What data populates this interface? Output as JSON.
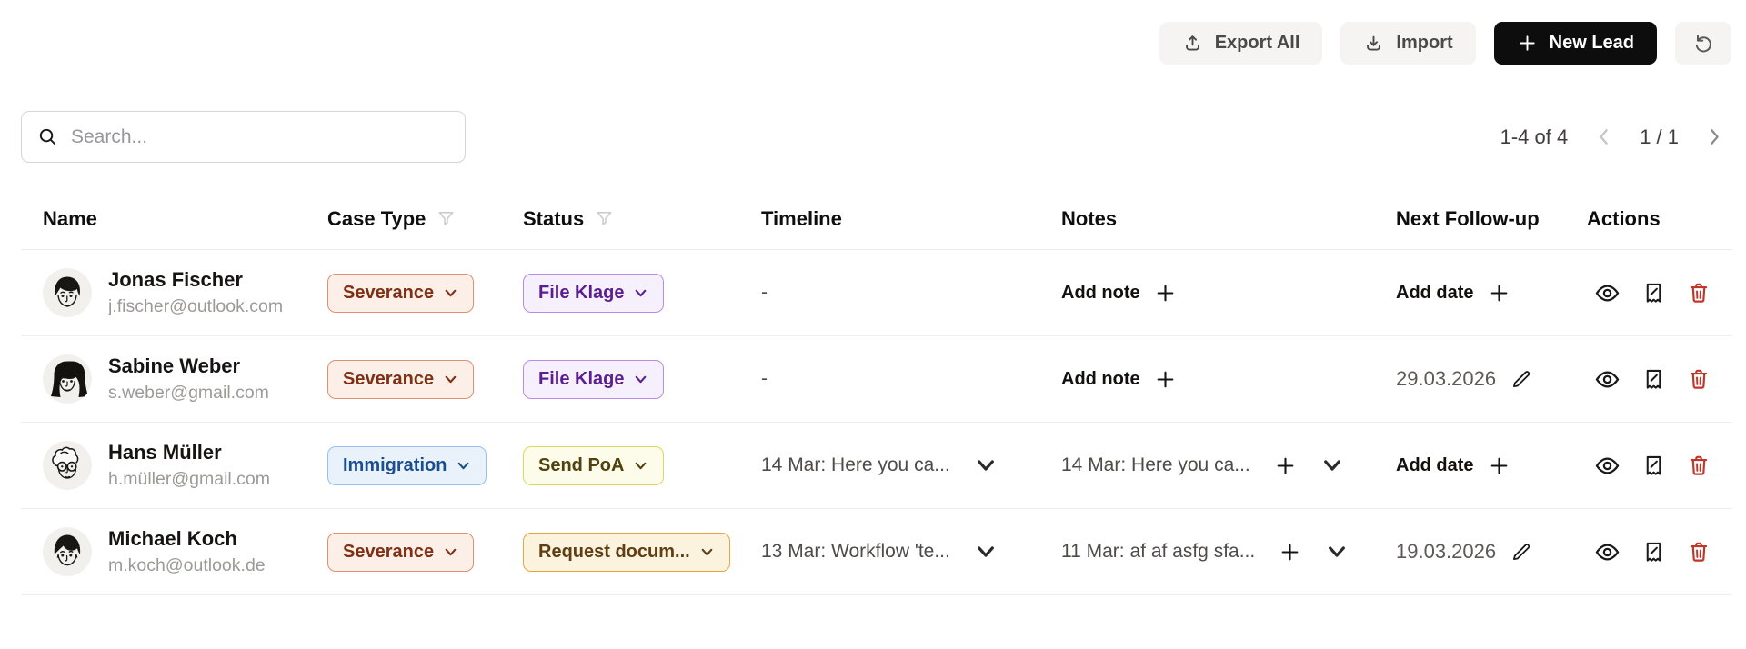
{
  "toolbar": {
    "export": "Export All",
    "import": "Import",
    "new_lead": "New Lead"
  },
  "search": {
    "placeholder": "Search..."
  },
  "pagination": {
    "range": "1-4 of 4",
    "page": "1 / 1"
  },
  "columns": [
    {
      "label": "Name"
    },
    {
      "label": "Case Type",
      "filter": true
    },
    {
      "label": "Status",
      "filter": true
    },
    {
      "label": "Timeline"
    },
    {
      "label": "Notes"
    },
    {
      "label": "Next Follow-up"
    },
    {
      "label": "Actions"
    }
  ],
  "badge_styles": {
    "severance": {
      "bg": "#FBEFE8",
      "border": "#DD9170",
      "text": "#7E2F14"
    },
    "immigration": {
      "bg": "#E9F1FB",
      "border": "#93C1EE",
      "text": "#1B4E8D"
    },
    "file_klage": {
      "bg": "#F6F0FC",
      "border": "#BA8AE6",
      "text": "#5A1E8F"
    },
    "send_poa": {
      "bg": "#FDFBEA",
      "border": "#DFD75B",
      "text": "#50410F"
    },
    "request_documents": {
      "bg": "#FCF3DF",
      "border": "#E3A640",
      "text": "#603E12"
    }
  },
  "rows": [
    {
      "name": "Jonas Fischer",
      "email": "j.fischer@outlook.com",
      "case_type": "Severance",
      "status": "File Klage",
      "timeline": "-",
      "notes_add": "Add note",
      "followup_add": "Add date"
    },
    {
      "name": "Sabine Weber",
      "email": "s.weber@gmail.com",
      "case_type": "Severance",
      "status": "File Klage",
      "timeline": "-",
      "notes_add": "Add note",
      "followup_date": "29.03.2026"
    },
    {
      "name": "Hans Müller",
      "email": "h.müller@gmail.com",
      "case_type": "Immigration",
      "status": "Send PoA",
      "timeline": "14 Mar: Here you ca...",
      "note": "14 Mar: Here you ca...",
      "followup_add": "Add date"
    },
    {
      "name": "Michael Koch",
      "email": "m.koch@outlook.de",
      "case_type": "Severance",
      "status": "Request docum...",
      "timeline": "13 Mar: Workflow 'te...",
      "note": "11 Mar: af af asfg sfa...",
      "followup_date": "19.03.2026"
    }
  ],
  "colors": {
    "new_lead_bg": "#0D0D0D",
    "toolbar_btn_bg": "#F5F4F2",
    "danger": "#C0362A",
    "row_border": "#EFEEEC",
    "header_text": "#0E0E0E",
    "email_text": "#9C9A98",
    "avatar_bg": "#F1F0ED"
  },
  "icons": {
    "search-icon": "magnifier",
    "upload-icon": "arrow-up-from-tray",
    "download-icon": "arrow-down-to-tray",
    "plus-icon": "plus",
    "refresh-icon": "circular-arrow",
    "filter-icon": "funnel",
    "chevron-down-icon": "chevron-down",
    "chevron-left-icon": "chevron-left",
    "chevron-right-icon": "chevron-right",
    "eye-icon": "eye",
    "note-edit-icon": "receipt-with-pencil",
    "trash-icon": "trash-can",
    "pencil-icon": "pencil"
  }
}
